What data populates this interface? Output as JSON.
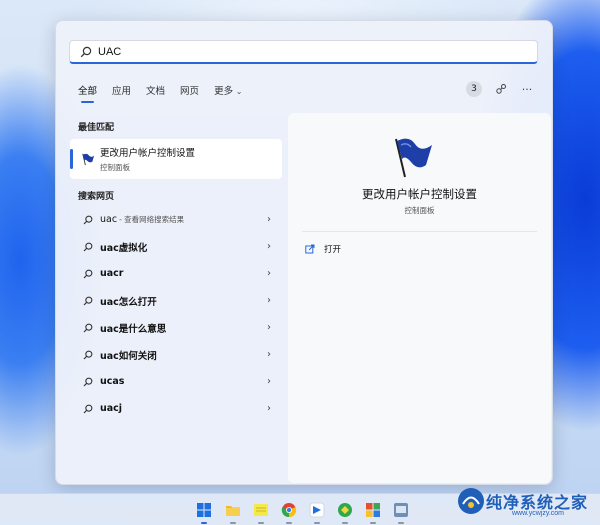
{
  "search": {
    "value": "UAC",
    "placeholder": ""
  },
  "tabs": [
    {
      "label": "全部"
    },
    {
      "label": "应用"
    },
    {
      "label": "文档"
    },
    {
      "label": "网页"
    },
    {
      "label": "更多"
    }
  ],
  "more_icon": "chevron-down-icon",
  "badge_count": "3",
  "options_label": "···",
  "best_match": {
    "section_title": "最佳匹配",
    "title": "更改用户帐户控制设置",
    "subtitle": "控制面板"
  },
  "web": {
    "section_title": "搜索网页",
    "items": [
      {
        "label": "uac",
        "hint": "- 查看网络搜索结果"
      },
      {
        "label": "uac虚拟化",
        "hint": ""
      },
      {
        "label": "uacr",
        "hint": ""
      },
      {
        "label": "uac怎么打开",
        "hint": ""
      },
      {
        "label": "uac是什么意思",
        "hint": ""
      },
      {
        "label": "uac如何关闭",
        "hint": ""
      },
      {
        "label": "ucas",
        "hint": ""
      },
      {
        "label": "uacj",
        "hint": ""
      }
    ]
  },
  "detail": {
    "title": "更改用户帐户控制设置",
    "subtitle": "控制面板",
    "open_label": "打开"
  },
  "watermark": {
    "text": "纯净系统之家",
    "url": "www.ycwjzy.com"
  },
  "colors": {
    "accent": "#2b66d9",
    "flag_blue": "#1f3fa8"
  }
}
